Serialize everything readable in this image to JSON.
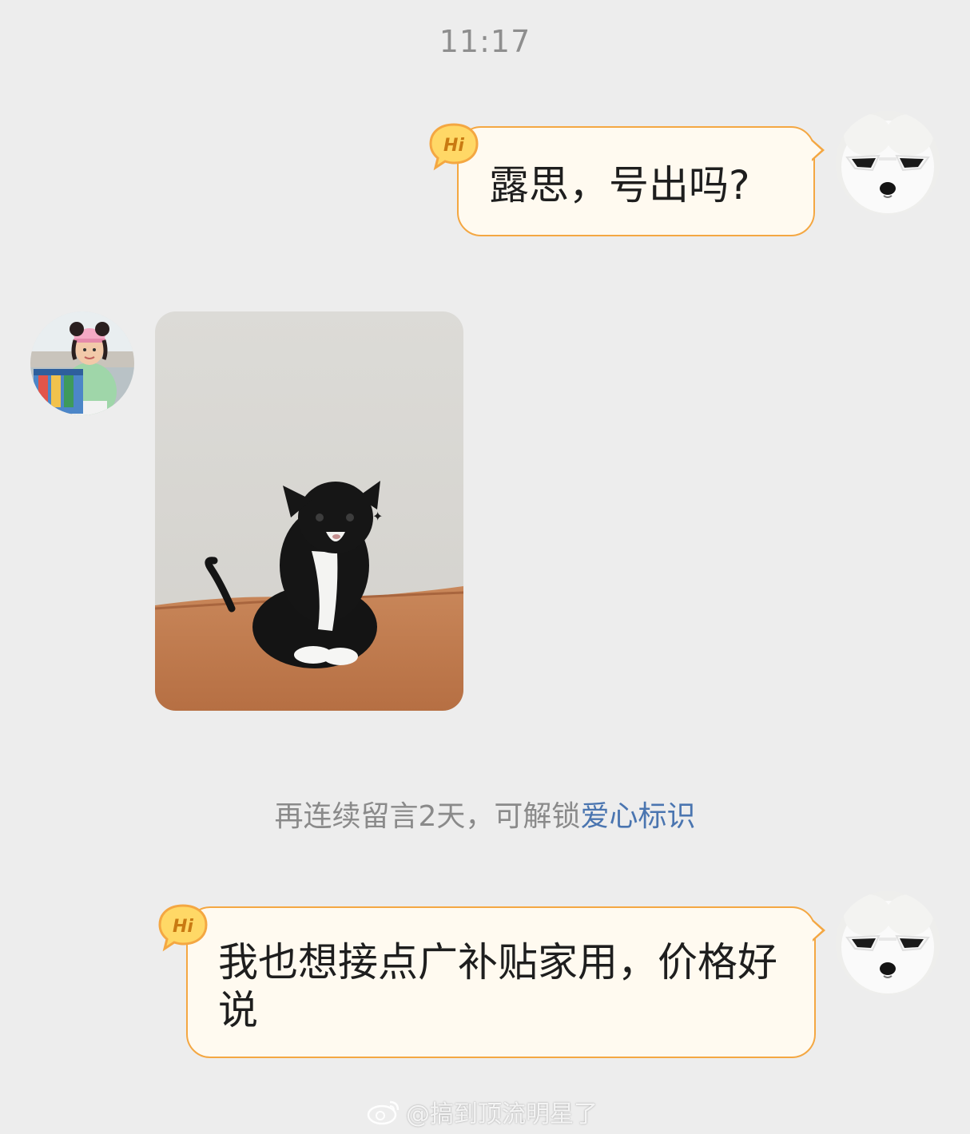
{
  "timestamp": "11:17",
  "messages": [
    {
      "sender": "me",
      "badge": "Hi",
      "text": "露思，号出吗?"
    },
    {
      "sender": "other",
      "type": "image"
    },
    {
      "sender": "me",
      "badge": "Hi",
      "text": "我也想接点广补贴家用，价格好说"
    }
  ],
  "system_note": {
    "prefix": "再连续留言2天，可解锁",
    "link": "爱心标识"
  },
  "watermark": "@搞到顶流明星了",
  "colors": {
    "background": "#ededed",
    "bubble_fill": "#fffaf0",
    "bubble_border": "#f4a742",
    "link": "#4a75b0"
  }
}
